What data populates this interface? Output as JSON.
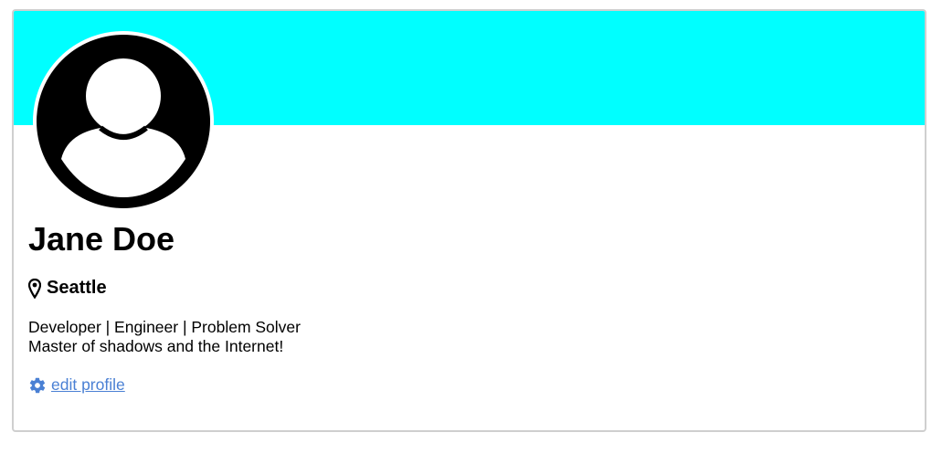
{
  "profile": {
    "name": "Jane Doe",
    "location": "Seattle",
    "bio_line1": "Developer | Engineer | Problem Solver",
    "bio_line2": "Master of shadows and the Internet!",
    "edit_label": "edit profile"
  },
  "colors": {
    "banner": "#00ffff",
    "link": "#4a80d4"
  },
  "icons": {
    "avatar": "user-avatar-icon",
    "location": "map-pin-icon",
    "edit": "gear-icon"
  }
}
